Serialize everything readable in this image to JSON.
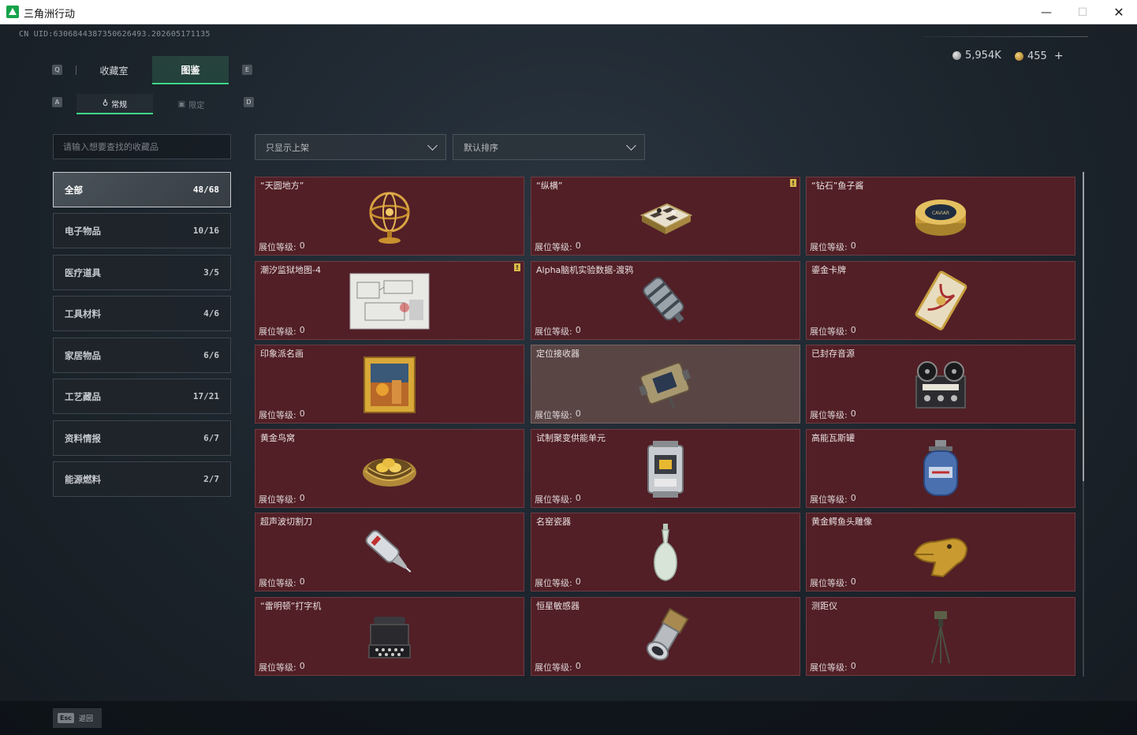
{
  "window": {
    "title": "三角洲行动",
    "minimize": "—",
    "maximize": "☐",
    "close": "✕"
  },
  "uid": "CN UID:6306844387350626493.202605171135",
  "currency": {
    "silver": "5,954K",
    "gold": "455",
    "plus": "+"
  },
  "keys": {
    "tab_left": "Q",
    "tab_right": "E",
    "sub_left": "A",
    "sub_right": "D"
  },
  "main_tabs": [
    {
      "label": "收藏室"
    },
    {
      "label": "图鉴"
    }
  ],
  "sub_tabs": [
    {
      "label": "常规"
    },
    {
      "label": "限定"
    }
  ],
  "search": {
    "placeholder": "请输入想要查找的收藏品"
  },
  "filters": {
    "shelf": "只显示上架",
    "sort": "默认排序"
  },
  "categories": [
    {
      "label": "全部",
      "count": "48/68"
    },
    {
      "label": "电子物品",
      "count": "10/16"
    },
    {
      "label": "医疗道具",
      "count": "3/5"
    },
    {
      "label": "工具材料",
      "count": "4/6"
    },
    {
      "label": "家居物品",
      "count": "6/6"
    },
    {
      "label": "工艺藏品",
      "count": "17/21"
    },
    {
      "label": "资料情报",
      "count": "6/7"
    },
    {
      "label": "能源燃料",
      "count": "2/7"
    }
  ],
  "level_label": "展位等级:",
  "items": [
    {
      "name": "“天圆地方”",
      "level": "0",
      "icon": "armillary-sphere-icon",
      "badge": ""
    },
    {
      "name": "“纵横”",
      "level": "0",
      "icon": "chessboard-icon",
      "badge": "!"
    },
    {
      "name": "“钻石”鱼子酱",
      "level": "0",
      "icon": "caviar-tin-icon",
      "badge": ""
    },
    {
      "name": "潮汐监狱地图-4",
      "level": "0",
      "icon": "map-blueprint-icon",
      "badge": "!"
    },
    {
      "name": "Alpha脑机实验数据-渡鸦",
      "level": "0",
      "icon": "data-canister-icon",
      "badge": ""
    },
    {
      "name": "鎏金卡牌",
      "level": "0",
      "icon": "gilded-card-icon",
      "badge": ""
    },
    {
      "name": "印象派名画",
      "level": "0",
      "icon": "framed-painting-icon",
      "badge": ""
    },
    {
      "name": "定位接收器",
      "level": "0",
      "icon": "gps-receiver-icon",
      "badge": ""
    },
    {
      "name": "已封存音源",
      "level": "0",
      "icon": "reel-recorder-icon",
      "badge": ""
    },
    {
      "name": "黄金鸟窝",
      "level": "0",
      "icon": "golden-nest-icon",
      "badge": ""
    },
    {
      "name": "试制聚变供能单元",
      "level": "0",
      "icon": "fusion-cell-icon",
      "badge": ""
    },
    {
      "name": "高能瓦斯罐",
      "level": "0",
      "icon": "gas-canister-icon",
      "badge": ""
    },
    {
      "name": "超声波切割刀",
      "level": "0",
      "icon": "ultrasonic-knife-icon",
      "badge": ""
    },
    {
      "name": "名窑瓷器",
      "level": "0",
      "icon": "porcelain-vase-icon",
      "badge": ""
    },
    {
      "name": "黄金鳄鱼头雕像",
      "level": "0",
      "icon": "gold-crocodile-icon",
      "badge": ""
    },
    {
      "name": "“雷明顿”打字机",
      "level": "0",
      "icon": "typewriter-icon",
      "badge": ""
    },
    {
      "name": "恒星敏感器",
      "level": "0",
      "icon": "star-sensor-icon",
      "badge": ""
    },
    {
      "name": "测距仪",
      "level": "0",
      "icon": "rangefinder-tripod-icon",
      "badge": ""
    }
  ],
  "bottom": {
    "esc_key": "Esc",
    "esc_label": "返回"
  },
  "colors": {
    "accent": "#3fd68a",
    "card_bg": "#521f26",
    "card_highlight": "#5a4545",
    "badge": "#d9b84a"
  }
}
